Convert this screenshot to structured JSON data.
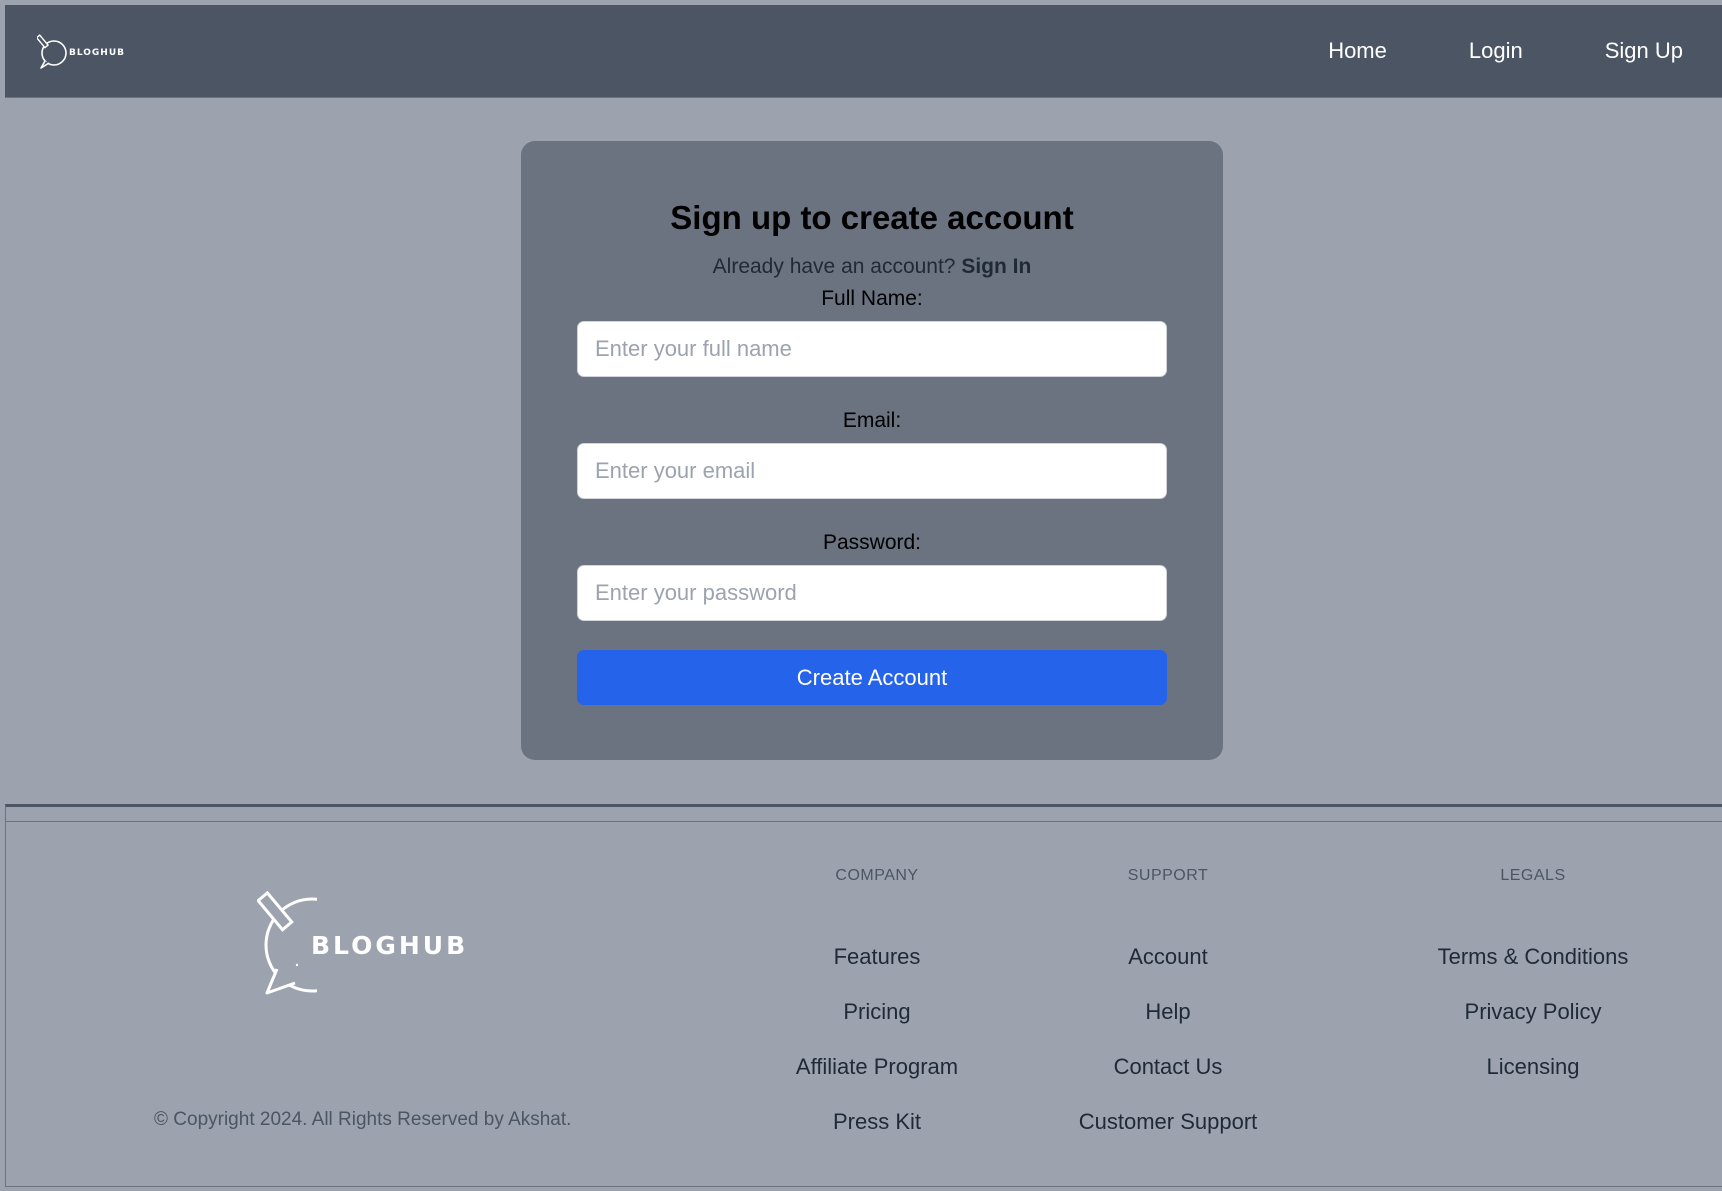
{
  "brand": {
    "name": "BLOGHUB"
  },
  "nav": {
    "links": [
      {
        "label": "Home"
      },
      {
        "label": "Login"
      },
      {
        "label": "Sign Up"
      }
    ]
  },
  "signup": {
    "title": "Sign up to create account",
    "prompt": "Already have an account?",
    "signin_label": "Sign In",
    "fields": {
      "full_name": {
        "label": "Full Name:",
        "placeholder": "Enter your full name",
        "value": ""
      },
      "email": {
        "label": "Email:",
        "placeholder": "Enter your email",
        "value": ""
      },
      "password": {
        "label": "Password:",
        "placeholder": "Enter your password",
        "value": ""
      }
    },
    "submit_label": "Create Account"
  },
  "footer": {
    "copyright": "© Copyright 2024. All Rights Reserved by Akshat.",
    "columns": [
      {
        "heading": "COMPANY",
        "links": [
          "Features",
          "Pricing",
          "Affiliate Program",
          "Press Kit"
        ]
      },
      {
        "heading": "SUPPORT",
        "links": [
          "Account",
          "Help",
          "Contact Us",
          "Customer Support"
        ]
      },
      {
        "heading": "LEGALS",
        "links": [
          "Terms & Conditions",
          "Privacy Policy",
          "Licensing"
        ]
      }
    ]
  },
  "colors": {
    "background": "#9ca3af",
    "navbar": "#4b5563",
    "card": "#6b7280",
    "primary_button": "#2563eb"
  }
}
